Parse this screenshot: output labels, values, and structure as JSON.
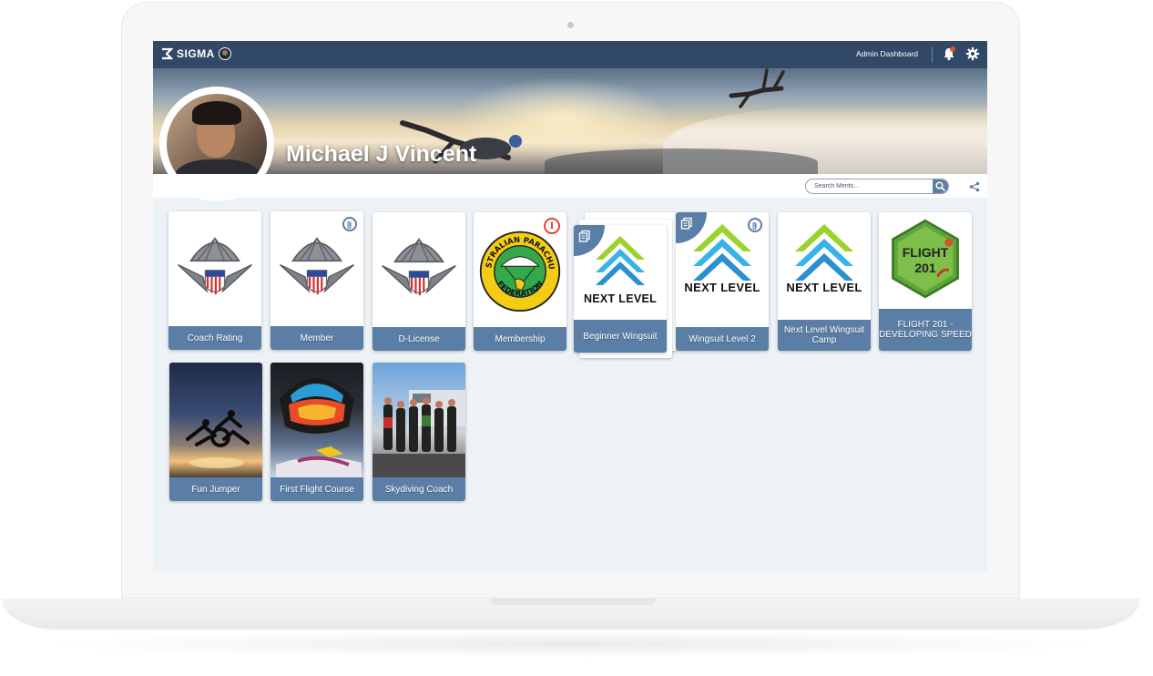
{
  "app": {
    "brand": "SIGMA"
  },
  "header": {
    "admin_label": "Admin Dashboard"
  },
  "profile": {
    "name": "Michael J Vincent"
  },
  "search": {
    "placeholder": "Search Merits..."
  },
  "badges": [
    {
      "label": "Coach Rating"
    },
    {
      "label": "Member"
    },
    {
      "label": "D-License"
    },
    {
      "label": "Membership",
      "art_text": {
        "top": "AUSTRALIAN PARACHUTE",
        "bottom": "FEDERATION"
      }
    },
    {
      "label": "Beginner Wingsuit",
      "art_text": "NEXT LEVEL"
    },
    {
      "label": "Wingsuit Level 2",
      "art_text": "NEXT LEVEL"
    },
    {
      "label": "Next Level Wingsuit Camp",
      "art_text": "NEXT LEVEL"
    },
    {
      "label": "FLIGHT 201 - DEVELOPING SPEED",
      "art_text": {
        "line1": "FLIGHT",
        "line2": "201"
      }
    },
    {
      "label": "Fun Jumper"
    },
    {
      "label": "First Flight Course"
    },
    {
      "label": "Skydiving Coach"
    }
  ],
  "colors": {
    "topbar": "#314866",
    "label_bar": "#5a7ea6",
    "screen_bg": "#edf2f6",
    "notification": "#e2532f",
    "info_badge": "#e0443c"
  }
}
